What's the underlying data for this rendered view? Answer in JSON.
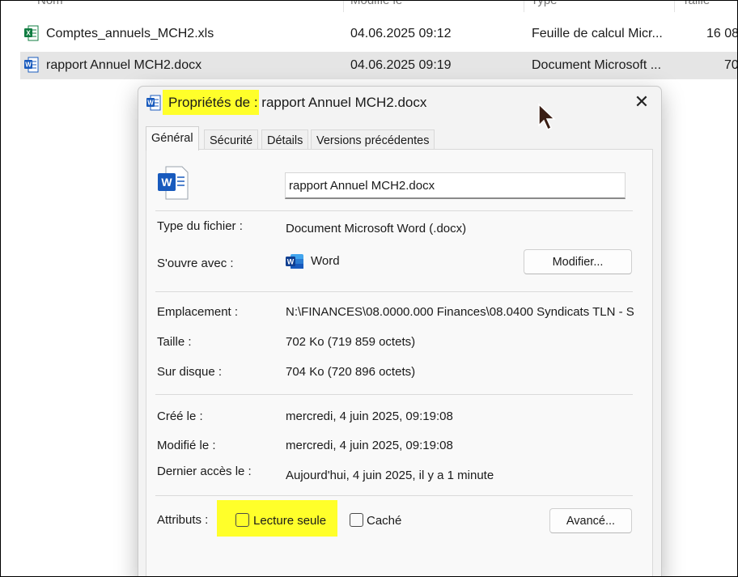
{
  "explorer": {
    "columns": [
      "Nom",
      "Modifié le",
      "Type",
      "Taille"
    ],
    "files": [
      {
        "name": "Comptes_annuels_MCH2.xls",
        "modified": "04.06.2025 09:12",
        "type": "Feuille de calcul Micr...",
        "size": "16 08",
        "icon": "excel-icon",
        "selected": false
      },
      {
        "name": "rapport Annuel MCH2.docx",
        "modified": "04.06.2025 09:19",
        "type": "Document Microsoft ...",
        "size": "70",
        "icon": "word-icon",
        "selected": true
      }
    ]
  },
  "dialog": {
    "title": "Propriétés de : rapport Annuel MCH2.docx",
    "close_symbol": "✕",
    "tabs": [
      "Général",
      "Sécurité",
      "Détails",
      "Versions précédentes"
    ],
    "active_tab": "Général",
    "filename_value": "rapport Annuel MCH2.docx",
    "type_label": "Type du fichier :",
    "type_value": "Document Microsoft Word (.docx)",
    "opens_label": "S'ouvre avec :",
    "opens_value": "Word",
    "modify_button": "Modifier...",
    "location_label": "Emplacement :",
    "location_value": "N:\\FINANCES\\08.0000.000 Finances\\08.0400 Syndicats  TLN - S",
    "size_label": "Taille :",
    "size_value": "702 Ko (719 859 octets)",
    "disk_label": "Sur disque :",
    "disk_value": "704 Ko (720 896 octets)",
    "created_label": "Créé le :",
    "created_value": "mercredi, 4 juin 2025, 09:19:08",
    "modified_label": "Modifié le :",
    "modified_value": "mercredi, 4 juin 2025, 09:19:08",
    "accessed_label": "Dernier accès le :",
    "accessed_value": "Aujourd'hui, 4 juin 2025, il y a 1 minute",
    "attributes_label": "Attributs :",
    "readonly_label": "Lecture seule",
    "readonly_checked": false,
    "hidden_label": "Caché",
    "hidden_checked": false,
    "advanced_button": "Avancé..."
  },
  "colors": {
    "highlight": "#ffff2a",
    "selected_row": "#e5e5e5",
    "word_blue": "#185abd",
    "excel_green": "#107c41"
  }
}
